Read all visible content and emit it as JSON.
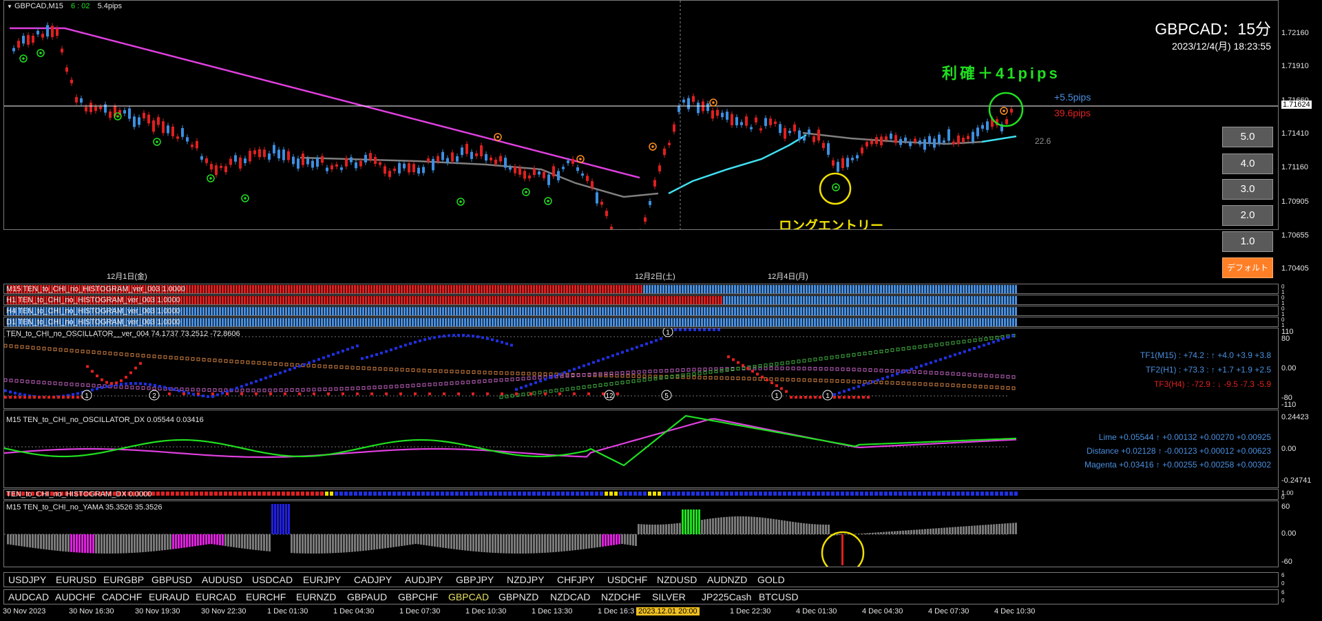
{
  "header": {
    "symbol": "GBPCAD,M15",
    "timer": "6 : 02",
    "spread": "5.4pips"
  },
  "title": {
    "pair": "GBPCAD：15分",
    "datetime": "2023/12/4(月) 18:23:55"
  },
  "annotations": {
    "profit": "利確＋41pips",
    "entry": "ロングエントリー",
    "plus_pips": "+5.5pips",
    "red_pips": "39.6pips",
    "ma_value": "22.6"
  },
  "price_axis": {
    "ticks": [
      "1.72160",
      "1.71910",
      "1.71660",
      "1.71410",
      "1.71160",
      "1.70905",
      "1.70655",
      "1.70405"
    ],
    "current": "1.71624"
  },
  "day_labels": [
    "12月1日(金)",
    "12月2日(土)",
    "12月4日(月)"
  ],
  "buttons": [
    "5.0",
    "4.0",
    "3.0",
    "2.0",
    "1.0",
    "デフォルト"
  ],
  "histogram_rows": [
    "M15 TEN_to_CHI_no_HISTOGRAM_ver_003 1.0000",
    "H1 TEN_to_CHI_no_HISTOGRAM_ver_003 1.0000",
    "H4 TEN_to_CHI_no_HISTOGRAM_ver_003 1.0000",
    "D1 TEN_to_CHI_no_HISTOGRAM_ver_003 1.0000"
  ],
  "histogram_row_ticks": [
    "0",
    "1",
    "0",
    "1",
    "0",
    "1",
    "0",
    "1"
  ],
  "oscillator": {
    "title": "TEN_to_CHI_no_OSCILLATOR__ver_004 74.1737 73.2512 -72.8606",
    "ticks": [
      "110",
      "80",
      "0.00",
      "-80",
      "-110"
    ],
    "tf1": "TF1(M15) : +74.2 : ↑ +4.0 +3.9 +3.8",
    "tf2": "TF2(H1) : +73.3 : ↑ +1.7 +1.9 +2.5",
    "tf3": "TF3(H4) : -72.9 : ↓ -9.5 -7.3 -5.9",
    "circles": [
      "1",
      "2",
      "12",
      "5",
      "1",
      "1",
      "1"
    ]
  },
  "dx": {
    "title": "M15 TEN_to_CHI_no_OSCILLATOR_DX  0.05544 0.03416",
    "ticks": [
      "0.24423",
      "0.00",
      "-0.24741"
    ],
    "lime": "Lime +0.05544 ↑ +0.00132 +0.00270 +0.00925",
    "distance": "Distance +0.02128 ↑ -0.00123 +0.00012 +0.00623",
    "magenta": "Magenta +0.03416 ↑ +0.00255 +0.00258 +0.00302"
  },
  "hist_dx": {
    "title": "TEN_to_CHI_no_HISTOGRAM_DX 0.0000",
    "ticks": [
      "1.00",
      "0"
    ]
  },
  "yama": {
    "title": "M15  TEN_to_CHI_no_YAMA  35.3526 35.3526",
    "ticks": [
      "60",
      "0.00",
      "-60"
    ]
  },
  "symbols_row1": [
    "USDJPY",
    "EURUSD",
    "EURGBP",
    "GBPUSD",
    "AUDUSD",
    "USDCAD",
    "EURJPY",
    "CADJPY",
    "AUDJPY",
    "GBPJPY",
    "NZDJPY",
    "CHFJPY",
    "USDCHF",
    "NZDUSD",
    "AUDNZD",
    "GOLD"
  ],
  "symbols_row2": [
    "AUDCAD",
    "AUDCHF",
    "CADCHF",
    "EURAUD",
    "EURCAD",
    "EURCHF",
    "EURNZD",
    "GBPAUD",
    "GBPCHF",
    "GBPCAD",
    "GBPNZD",
    "NZDCAD",
    "NZDCHF",
    "SILVER",
    "JP225Cash",
    "BTCUSD"
  ],
  "symbols_row_ticks": [
    "6",
    "0",
    "6",
    "0"
  ],
  "active_symbol": "GBPCAD",
  "time_axis": [
    "30 Nov 2023",
    "30 Nov 16:30",
    "30 Nov 19:30",
    "30 Nov 22:30",
    "1 Dec 01:30",
    "1 Dec 04:30",
    "1 Dec 07:30",
    "1 Dec 10:30",
    "1 Dec 13:30",
    "1 Dec 16:3",
    "2023.12.01 20:00",
    "1 Dec 22:30",
    "4 Dec 01:30",
    "4 Dec 04:30",
    "4 Dec 07:30",
    "4 Dec 10:30"
  ],
  "colors": {
    "bull": "#3d8fe0",
    "bear": "#e02020",
    "ma_magenta": "#e040e0",
    "ma_cyan": "#40e0f0",
    "ma_gray": "#808080",
    "lime": "#20e020",
    "yellow": "#f0e000",
    "hist_red": "#e02020",
    "hist_blue": "#4a90e0"
  }
}
